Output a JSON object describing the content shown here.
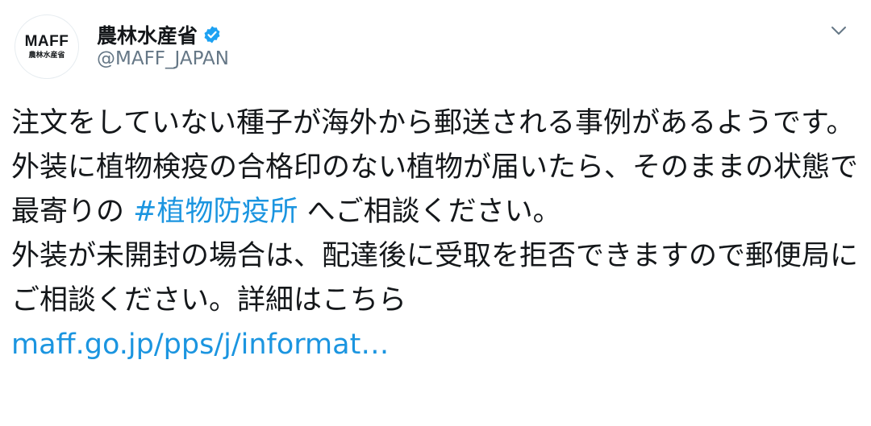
{
  "account": {
    "avatar_logo": "MAFF",
    "avatar_sub": "農林水産省",
    "display_name": "農林水産省",
    "handle": "@MAFF_JAPAN",
    "verified": true
  },
  "icons": {
    "verified": "verified-badge-icon",
    "menu": "chevron-down-icon"
  },
  "colors": {
    "link": "#1b95e0",
    "text": "#14171a",
    "secondary": "#657786"
  },
  "tweet": {
    "para1_before_hashtag": "注文をしていない種子が海外から郵送される事例があるようです。外装に植物検疫の合格印のない植物が届いたら、そのままの状態で最寄りの ",
    "hashtag": "#植物防疫所",
    "para1_after_hashtag": " へご相談ください。",
    "para2": "外装が未開封の場合は、配達後に受取を拒否できますので郵便局にご相談ください。詳細はこちら",
    "link": "maff.go.jp/pps/j/informat…"
  }
}
